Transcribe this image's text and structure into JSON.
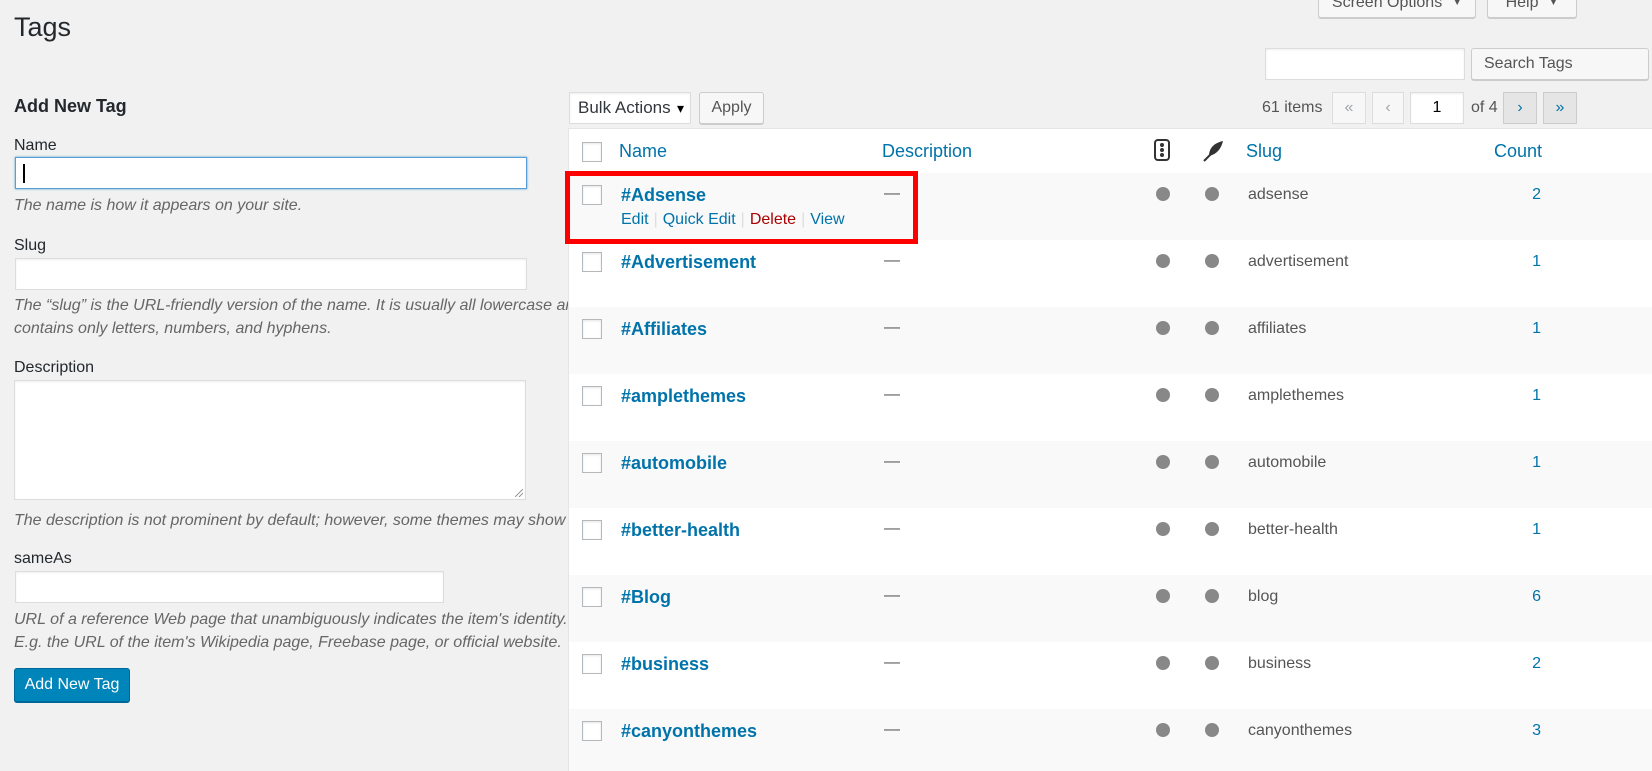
{
  "page": {
    "title": "Tags"
  },
  "top_buttons": {
    "screen_options": "Screen Options",
    "help": "Help",
    "caret": "▼"
  },
  "search": {
    "value": "",
    "button": "Search Tags"
  },
  "form": {
    "heading": "Add New Tag",
    "name_label": "Name",
    "name_help": "The name is how it appears on your site.",
    "slug_label": "Slug",
    "slug_help_1": "The “slug” is the URL-friendly version of the name. It is usually all lowercase and",
    "slug_help_2": "contains only letters, numbers, and hyphens.",
    "desc_label": "Description",
    "desc_help": "The description is not prominent by default; however, some themes may show it.",
    "sameas_label": "sameAs",
    "sameas_help_1": "URL of a reference Web page that unambiguously indicates the item's identity.",
    "sameas_help_2": "E.g. the URL of the item's Wikipedia page, Freebase page, or official website.",
    "submit": "Add New Tag"
  },
  "bulk": {
    "selected": "Bulk Actions",
    "caret": "▾",
    "apply": "Apply"
  },
  "pagination": {
    "items": "61 items",
    "first": "«",
    "prev": "‹",
    "current": "1",
    "of": "of 4",
    "next": "›",
    "last": "»"
  },
  "columns": {
    "name": "Name",
    "description": "Description",
    "slug": "Slug",
    "count": "Count"
  },
  "row_actions": {
    "edit": "Edit",
    "quick_edit": "Quick Edit",
    "delete": "Delete",
    "view": "View",
    "sep": "|"
  },
  "rows": [
    {
      "name": "#Adsense",
      "description": "—",
      "slug": "adsense",
      "count": "2"
    },
    {
      "name": "#Advertisement",
      "description": "—",
      "slug": "advertisement",
      "count": "1"
    },
    {
      "name": "#Affiliates",
      "description": "—",
      "slug": "affiliates",
      "count": "1"
    },
    {
      "name": "#amplethemes",
      "description": "—",
      "slug": "amplethemes",
      "count": "1"
    },
    {
      "name": "#automobile",
      "description": "—",
      "slug": "automobile",
      "count": "1"
    },
    {
      "name": "#better-health",
      "description": "—",
      "slug": "better-health",
      "count": "1"
    },
    {
      "name": "#Blog",
      "description": "—",
      "slug": "blog",
      "count": "6"
    },
    {
      "name": "#business",
      "description": "—",
      "slug": "business",
      "count": "2"
    },
    {
      "name": "#canyonthemes",
      "description": "—",
      "slug": "canyonthemes",
      "count": "3"
    }
  ],
  "colors": {
    "link": "#0073aa",
    "delete": "#a00",
    "primary": "#0085ba",
    "highlight": "#ff0000",
    "dot": "#888888"
  }
}
